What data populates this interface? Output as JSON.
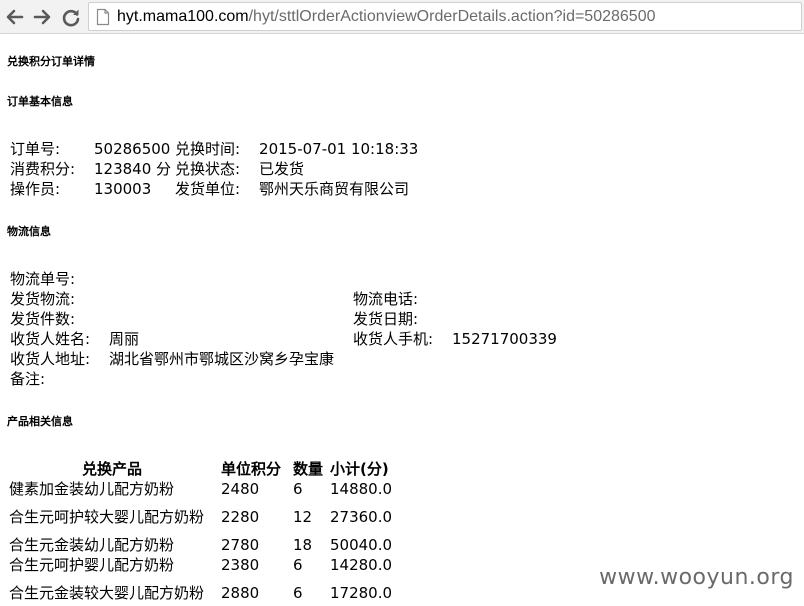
{
  "browser": {
    "url_host": "hyt.mama100.com",
    "url_path": "/hyt/sttlOrderActionviewOrderDetails.action?id=50286500"
  },
  "page": {
    "title": "兑换积分订单详情"
  },
  "order": {
    "heading": "订单基本信息",
    "rows": [
      [
        "订单号:",
        "50286500",
        "兑换时间:",
        "2015-07-01 10:18:33"
      ],
      [
        "消费积分:",
        "123840 分",
        "兑换状态:",
        "已发货"
      ],
      [
        "操作员:",
        "130003",
        "发货单位:",
        "鄂州天乐商贸有限公司"
      ]
    ]
  },
  "logistics": {
    "heading": "物流信息",
    "rows": [
      [
        "物流单号:",
        "",
        "",
        ""
      ],
      [
        "发货物流:",
        "",
        "物流电话:",
        ""
      ],
      [
        "发货件数:",
        "",
        "发货日期:",
        ""
      ],
      [
        "收货人姓名:",
        "周丽",
        "收货人手机:",
        "15271700339"
      ],
      [
        "收货人地址:",
        "湖北省鄂州市鄂城区沙窝乡孕宝康",
        "",
        ""
      ],
      [
        "备注:",
        "",
        "",
        ""
      ]
    ]
  },
  "products": {
    "heading": "产品相关信息",
    "columns": [
      "兑换产品",
      "单位积分",
      "数量",
      "小计(分)"
    ],
    "rows": [
      [
        "健素加金装幼儿配方奶粉",
        "2480",
        "6",
        "14880.0"
      ],
      [
        "合生元呵护较大婴儿配方奶粉",
        "2280",
        "12",
        "27360.0"
      ],
      [
        "合生元金装幼儿配方奶粉",
        "2780",
        "18",
        "50040.0"
      ],
      [
        "合生元呵护婴儿配方奶粉",
        "2380",
        "6",
        "14280.0"
      ],
      [
        "合生元金装较大婴儿配方奶粉",
        "2880",
        "6",
        "17280.0"
      ]
    ]
  },
  "watermark": "www.wooyun.org",
  "colors": {
    "toolbar_bg": "#f2f2f2",
    "url_host": "#000000",
    "url_path": "#6b6b6b"
  }
}
